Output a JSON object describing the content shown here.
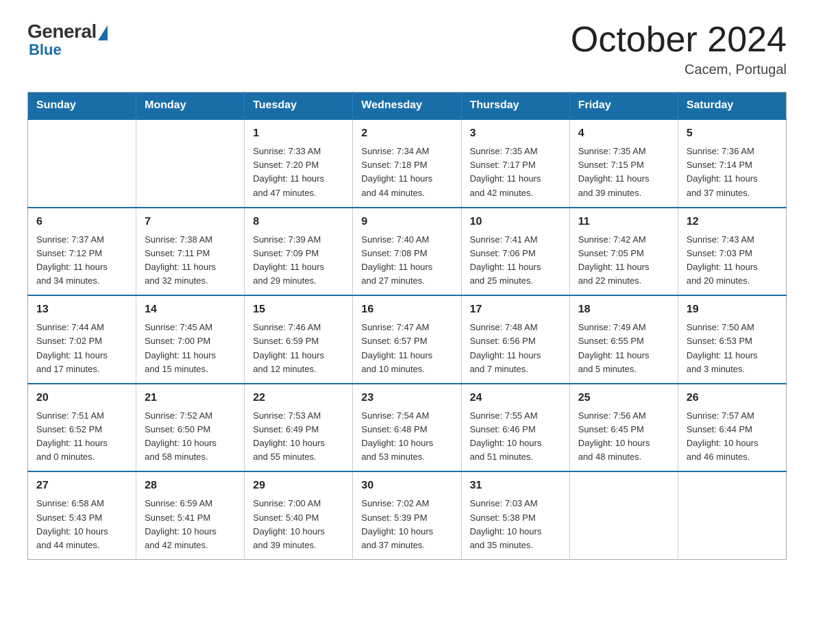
{
  "logo": {
    "general": "General",
    "blue": "Blue"
  },
  "title": "October 2024",
  "location": "Cacem, Portugal",
  "days_of_week": [
    "Sunday",
    "Monday",
    "Tuesday",
    "Wednesday",
    "Thursday",
    "Friday",
    "Saturday"
  ],
  "weeks": [
    [
      {
        "day": "",
        "info": ""
      },
      {
        "day": "",
        "info": ""
      },
      {
        "day": "1",
        "info": "Sunrise: 7:33 AM\nSunset: 7:20 PM\nDaylight: 11 hours\nand 47 minutes."
      },
      {
        "day": "2",
        "info": "Sunrise: 7:34 AM\nSunset: 7:18 PM\nDaylight: 11 hours\nand 44 minutes."
      },
      {
        "day": "3",
        "info": "Sunrise: 7:35 AM\nSunset: 7:17 PM\nDaylight: 11 hours\nand 42 minutes."
      },
      {
        "day": "4",
        "info": "Sunrise: 7:35 AM\nSunset: 7:15 PM\nDaylight: 11 hours\nand 39 minutes."
      },
      {
        "day": "5",
        "info": "Sunrise: 7:36 AM\nSunset: 7:14 PM\nDaylight: 11 hours\nand 37 minutes."
      }
    ],
    [
      {
        "day": "6",
        "info": "Sunrise: 7:37 AM\nSunset: 7:12 PM\nDaylight: 11 hours\nand 34 minutes."
      },
      {
        "day": "7",
        "info": "Sunrise: 7:38 AM\nSunset: 7:11 PM\nDaylight: 11 hours\nand 32 minutes."
      },
      {
        "day": "8",
        "info": "Sunrise: 7:39 AM\nSunset: 7:09 PM\nDaylight: 11 hours\nand 29 minutes."
      },
      {
        "day": "9",
        "info": "Sunrise: 7:40 AM\nSunset: 7:08 PM\nDaylight: 11 hours\nand 27 minutes."
      },
      {
        "day": "10",
        "info": "Sunrise: 7:41 AM\nSunset: 7:06 PM\nDaylight: 11 hours\nand 25 minutes."
      },
      {
        "day": "11",
        "info": "Sunrise: 7:42 AM\nSunset: 7:05 PM\nDaylight: 11 hours\nand 22 minutes."
      },
      {
        "day": "12",
        "info": "Sunrise: 7:43 AM\nSunset: 7:03 PM\nDaylight: 11 hours\nand 20 minutes."
      }
    ],
    [
      {
        "day": "13",
        "info": "Sunrise: 7:44 AM\nSunset: 7:02 PM\nDaylight: 11 hours\nand 17 minutes."
      },
      {
        "day": "14",
        "info": "Sunrise: 7:45 AM\nSunset: 7:00 PM\nDaylight: 11 hours\nand 15 minutes."
      },
      {
        "day": "15",
        "info": "Sunrise: 7:46 AM\nSunset: 6:59 PM\nDaylight: 11 hours\nand 12 minutes."
      },
      {
        "day": "16",
        "info": "Sunrise: 7:47 AM\nSunset: 6:57 PM\nDaylight: 11 hours\nand 10 minutes."
      },
      {
        "day": "17",
        "info": "Sunrise: 7:48 AM\nSunset: 6:56 PM\nDaylight: 11 hours\nand 7 minutes."
      },
      {
        "day": "18",
        "info": "Sunrise: 7:49 AM\nSunset: 6:55 PM\nDaylight: 11 hours\nand 5 minutes."
      },
      {
        "day": "19",
        "info": "Sunrise: 7:50 AM\nSunset: 6:53 PM\nDaylight: 11 hours\nand 3 minutes."
      }
    ],
    [
      {
        "day": "20",
        "info": "Sunrise: 7:51 AM\nSunset: 6:52 PM\nDaylight: 11 hours\nand 0 minutes."
      },
      {
        "day": "21",
        "info": "Sunrise: 7:52 AM\nSunset: 6:50 PM\nDaylight: 10 hours\nand 58 minutes."
      },
      {
        "day": "22",
        "info": "Sunrise: 7:53 AM\nSunset: 6:49 PM\nDaylight: 10 hours\nand 55 minutes."
      },
      {
        "day": "23",
        "info": "Sunrise: 7:54 AM\nSunset: 6:48 PM\nDaylight: 10 hours\nand 53 minutes."
      },
      {
        "day": "24",
        "info": "Sunrise: 7:55 AM\nSunset: 6:46 PM\nDaylight: 10 hours\nand 51 minutes."
      },
      {
        "day": "25",
        "info": "Sunrise: 7:56 AM\nSunset: 6:45 PM\nDaylight: 10 hours\nand 48 minutes."
      },
      {
        "day": "26",
        "info": "Sunrise: 7:57 AM\nSunset: 6:44 PM\nDaylight: 10 hours\nand 46 minutes."
      }
    ],
    [
      {
        "day": "27",
        "info": "Sunrise: 6:58 AM\nSunset: 5:43 PM\nDaylight: 10 hours\nand 44 minutes."
      },
      {
        "day": "28",
        "info": "Sunrise: 6:59 AM\nSunset: 5:41 PM\nDaylight: 10 hours\nand 42 minutes."
      },
      {
        "day": "29",
        "info": "Sunrise: 7:00 AM\nSunset: 5:40 PM\nDaylight: 10 hours\nand 39 minutes."
      },
      {
        "day": "30",
        "info": "Sunrise: 7:02 AM\nSunset: 5:39 PM\nDaylight: 10 hours\nand 37 minutes."
      },
      {
        "day": "31",
        "info": "Sunrise: 7:03 AM\nSunset: 5:38 PM\nDaylight: 10 hours\nand 35 minutes."
      },
      {
        "day": "",
        "info": ""
      },
      {
        "day": "",
        "info": ""
      }
    ]
  ]
}
